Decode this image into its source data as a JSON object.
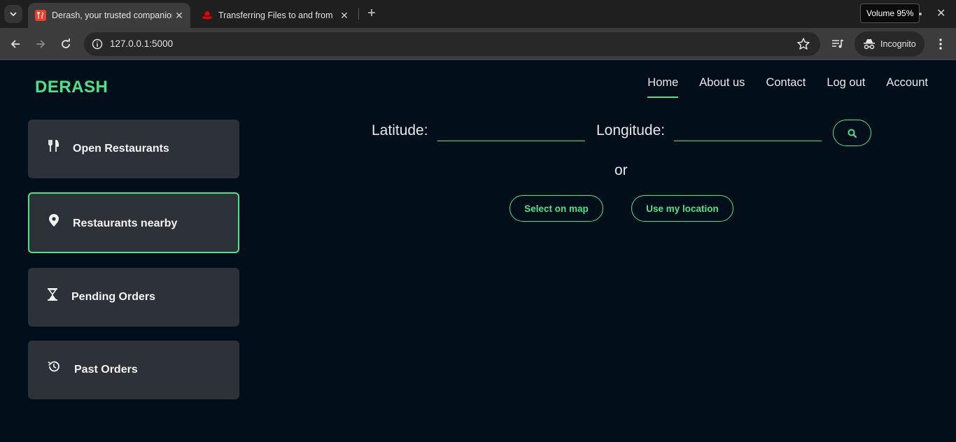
{
  "browser": {
    "tabs": [
      {
        "title": "Derash, your trusted companion",
        "favicon": "fork-knife-icon",
        "active": true
      },
      {
        "title": "Transferring Files to and from",
        "favicon": "redhat-icon",
        "active": false
      }
    ],
    "url": "127.0.0.1:5000",
    "incognito_label": "Incognito",
    "volume_tooltip": "Volume 95%"
  },
  "site": {
    "logo": "DERASH",
    "nav": [
      "Home",
      "About us",
      "Contact",
      "Log out",
      "Account"
    ],
    "active_nav": "Home"
  },
  "sidebar": {
    "items": [
      {
        "label": "Open Restaurants",
        "icon": "utensils-icon"
      },
      {
        "label": "Restaurants nearby",
        "icon": "location-pin-icon",
        "selected": true
      },
      {
        "label": "Pending Orders",
        "icon": "hourglass-icon"
      },
      {
        "label": "Past Orders",
        "icon": "history-icon"
      }
    ]
  },
  "location_form": {
    "latitude_label": "Latitude:",
    "latitude_value": "",
    "longitude_label": "Longitude:",
    "longitude_value": "",
    "search_icon": "search-icon",
    "or_text": "or",
    "select_on_map": "Select on map",
    "use_my_location": "Use my location"
  },
  "colors": {
    "accent": "#4be38a",
    "page_background": "#020f1a",
    "card_background": "#2d3239"
  }
}
